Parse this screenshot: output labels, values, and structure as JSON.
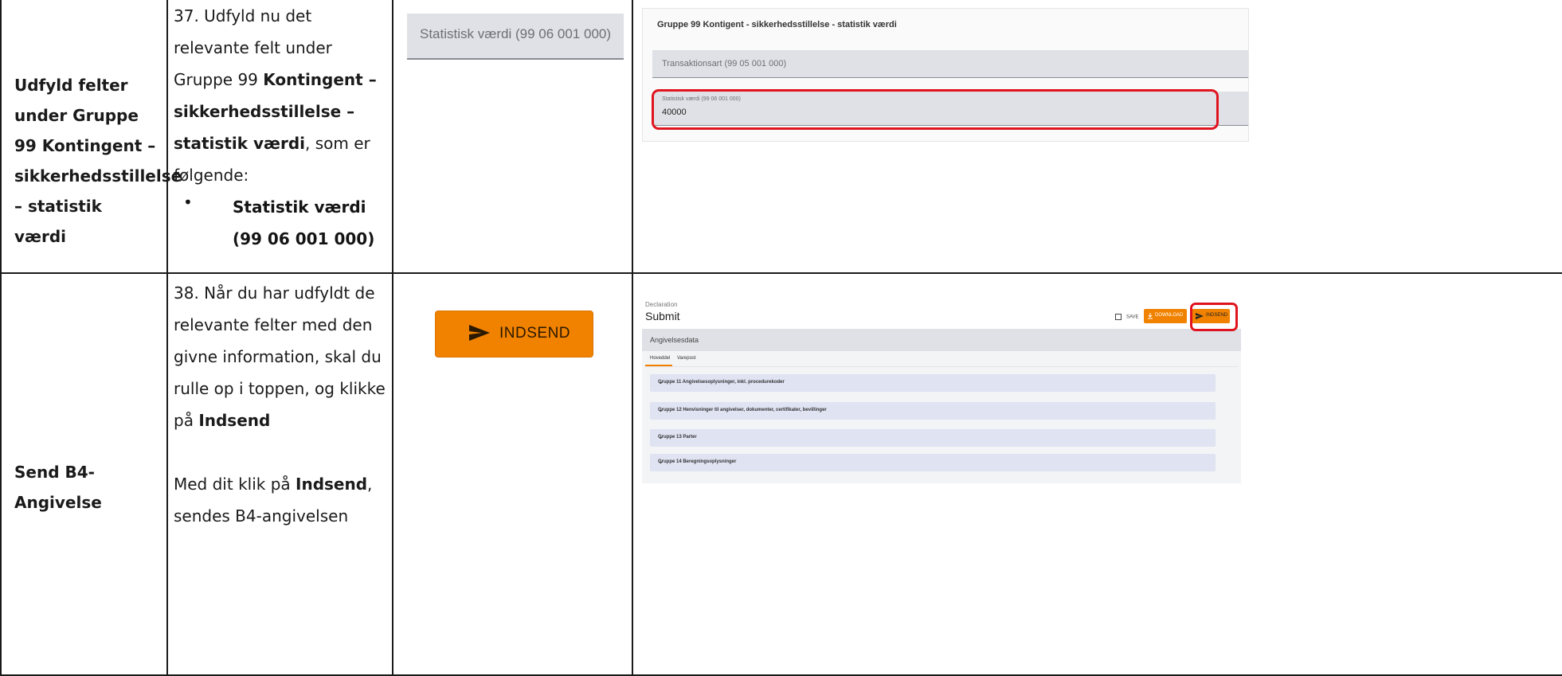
{
  "rows": [
    {
      "step_name": "Udfyld felter under Gruppe 99 Kontingent – sikkerhedsstillelse – statistik værdi",
      "step_number": "37.",
      "instruction_pre": "Udfyld nu det relevante felt under Gruppe 99",
      "instruction_bold": "Kontingent – sikkerhedsstillelse – statistik værdi",
      "instruction_post": ", som er følgende:",
      "bullet": "Statistik værdi (99 06 001 000)",
      "field_crop_label": "Statistisk værdi (99 06 001 000)",
      "screenshot": {
        "title": "Gruppe 99 Kontigent - sikkerhedsstillelse - statistik værdi",
        "field1_label": "Transaktionsart (99 05 001 000)",
        "field2_label": "Statistisk værdi (99 06 001 000)",
        "field2_value": "40000"
      }
    },
    {
      "step_name": "Send B4-Angivelse",
      "step_number": "38.",
      "instruction_pre": "Når du har udfyldt de relevante felter med den givne information, skal du rulle op i toppen, og klikke på",
      "instruction_bold": "Indsend",
      "instruction2_pre": "Med dit klik på",
      "instruction2_bold": "Indsend",
      "instruction2_post": ", sendes B4-angivelsen",
      "button_crop_label": "INDSEND",
      "screenshot": {
        "breadcrumb": "Declaration",
        "title": "Submit",
        "save": "SAVE",
        "download": "DOWNLOAD",
        "indsend": "INDSEND",
        "section": "Angivelsesdata",
        "tabs": [
          "Hoveddel",
          "Varepost"
        ],
        "groups": [
          "Gruppe 11 Angivelsesoplysninger, inkl. procedurekoder",
          "Gruppe 12 Henvisninger til angivelser, dokumenter, certifikater, bevillinger",
          "Gruppe 13 Parter",
          "Gruppe 14 Beregningsoplysninger"
        ]
      }
    }
  ],
  "colors": {
    "accent": "#f08200",
    "highlight": "#e0141e",
    "field_bg": "#dfe1e6"
  }
}
